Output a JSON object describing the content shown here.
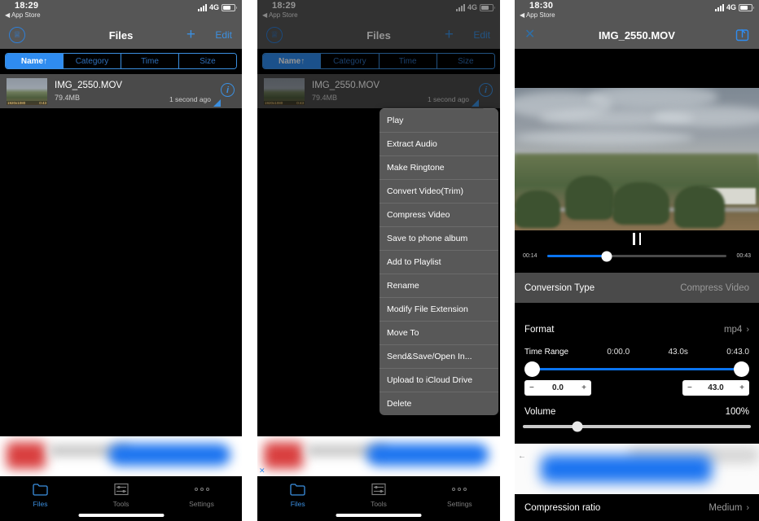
{
  "panel1": {
    "status": {
      "time": "18:29",
      "back_label": "App Store",
      "network": "4G"
    },
    "nav": {
      "title": "Files",
      "vip_icon": "crown-badge-icon",
      "plus_label": "+",
      "edit_label": "Edit"
    },
    "segments": [
      {
        "label": "Name↑",
        "active": true
      },
      {
        "label": "Category",
        "active": false
      },
      {
        "label": "Time",
        "active": false
      },
      {
        "label": "Size",
        "active": false
      }
    ],
    "file": {
      "name": "IMG_2550.MOV",
      "size": "79.4MB",
      "modified": "1 second ago",
      "thumb_resolution": "1920x1080",
      "thumb_duration": "0:43"
    },
    "tabs": [
      {
        "label": "Files",
        "icon": "folder-icon",
        "active": true
      },
      {
        "label": "Tools",
        "icon": "sliders-icon",
        "active": false
      },
      {
        "label": "Settings",
        "icon": "more-dots-icon",
        "active": false
      }
    ]
  },
  "panel2": {
    "status": {
      "time": "18:29",
      "back_label": "App Store",
      "network": "4G"
    },
    "nav": {
      "title": "Files",
      "plus_label": "+",
      "edit_label": "Edit"
    },
    "segments": [
      {
        "label": "Name↑",
        "active": true
      },
      {
        "label": "Category",
        "active": false
      },
      {
        "label": "Time",
        "active": false
      },
      {
        "label": "Size",
        "active": false
      }
    ],
    "file": {
      "name": "IMG_2550.MOV",
      "size": "79.4MB",
      "modified": "1 second ago",
      "thumb_resolution": "1920x1080",
      "thumb_duration": "0:43"
    },
    "context_menu": [
      "Play",
      "Extract Audio",
      "Make Ringtone",
      "Convert Video(Trim)",
      "Compress Video",
      "Save to phone album",
      "Add to Playlist",
      "Rename",
      "Modify File Extension",
      "Move To",
      "Send&Save/Open In...",
      "Upload to iCloud Drive",
      "Delete"
    ],
    "ad_close_label": "✕",
    "tabs": [
      {
        "label": "Files",
        "icon": "folder-icon",
        "active": true
      },
      {
        "label": "Tools",
        "icon": "sliders-icon",
        "active": false
      },
      {
        "label": "Settings",
        "icon": "more-dots-icon",
        "active": false
      }
    ]
  },
  "panel3": {
    "status": {
      "time": "18:30",
      "back_label": "App Store",
      "network": "4G"
    },
    "nav": {
      "title": "IMG_2550.MOV",
      "close_icon": "close-x-icon",
      "share_icon": "share-export-icon"
    },
    "player": {
      "elapsed": "00:14",
      "total": "00:43",
      "state_icon": "pause-icon",
      "progress_percent": 33
    },
    "conversion_type": {
      "label": "Conversion Type",
      "value": "Compress Video"
    },
    "format": {
      "label": "Format",
      "value": "mp4"
    },
    "time_range": {
      "label": "Time Range",
      "start": "0:00.0",
      "duration": "43.0s",
      "end": "0:43.0",
      "start_stepper": "0.0",
      "end_stepper": "43.0",
      "minus": "−",
      "plus": "+"
    },
    "volume": {
      "label": "Volume",
      "value": "100%"
    },
    "compression_ratio": {
      "label": "Compression ratio",
      "value": "Medium"
    },
    "back_arrow": "←"
  },
  "colors": {
    "accent_blue": "#3b8fe0",
    "active_blue": "#2f8cf0",
    "bar_gray": "#565656",
    "row_gray": "#4a4a4a",
    "menu_gray": "#585858"
  }
}
